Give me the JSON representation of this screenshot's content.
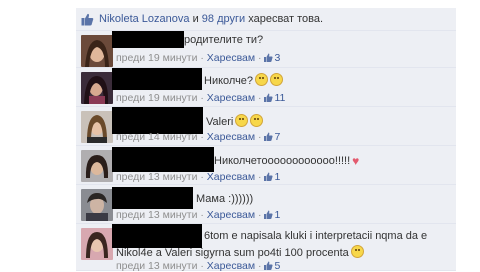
{
  "likes": {
    "name": "Nikoleta Lozanova",
    "conj": " и ",
    "others": "98 други",
    "suffix": " харесват това."
  },
  "comments": [
    {
      "text": "родителите ти?",
      "time": "преди 19 минути",
      "like": "Харесвам",
      "count": "3",
      "emoji": ""
    },
    {
      "text": "Николче?",
      "time": "преди 19 минути",
      "like": "Харесвам",
      "count": "11",
      "emoji": "smiley-smiley"
    },
    {
      "text": "Valeri",
      "time": "преди 14 минути",
      "like": "Харесвам",
      "count": "7",
      "emoji": "smiley-smiley"
    },
    {
      "text": "Николчетоооооооооооо!!!!!",
      "time": "преди 13 минути",
      "like": "Харесвам",
      "count": "1",
      "emoji": "heart"
    },
    {
      "text": "Мама :))))))",
      "time": "преди 13 минути",
      "like": "Харесвам",
      "count": "1",
      "emoji": ""
    },
    {
      "text_line1": "6tom e napisala kluki i interpretacii nqma da e",
      "text_line2": "Nikol4e a Valeri sigyrna sum po4ti 100 procenta",
      "time": "преди 13 минути",
      "like": "Харесвам",
      "count": "5",
      "emoji": "smiley"
    }
  ],
  "separator": " · ",
  "colors": {
    "panel_bg": "#edeff4",
    "link": "#3b5998",
    "meta": "#8f8f8f"
  }
}
